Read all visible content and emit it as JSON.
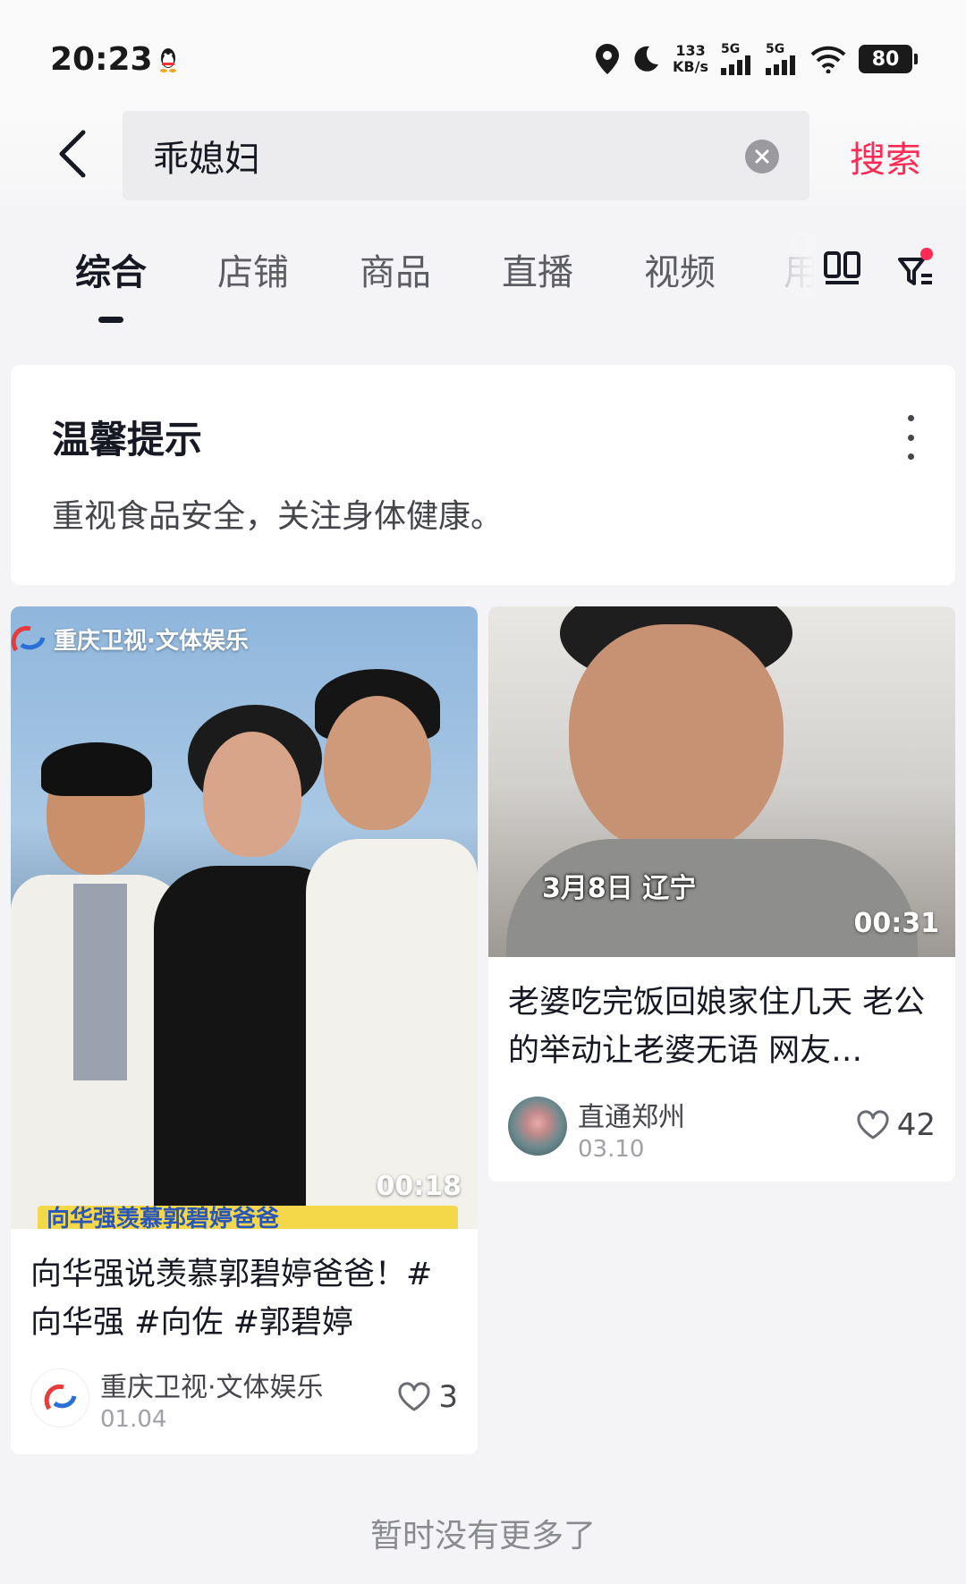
{
  "status_bar": {
    "time": "20:23",
    "net_speed_value": "133",
    "net_speed_unit": "KB/s",
    "signal_1": "5G",
    "signal_2": "5G",
    "battery": "80"
  },
  "search": {
    "query": "乖媳妇",
    "search_label": "搜索"
  },
  "tabs": [
    {
      "label": "综合",
      "active": true
    },
    {
      "label": "店铺"
    },
    {
      "label": "商品"
    },
    {
      "label": "直播"
    },
    {
      "label": "视频"
    },
    {
      "label": "用"
    }
  ],
  "tip": {
    "title": "温馨提示",
    "text": "重视食品安全，关注身体健康。"
  },
  "cards": [
    {
      "watermark": "重庆卫视·文体娱乐",
      "duration": "00:18",
      "banner": "向华强羡慕郭碧婷爸爸",
      "title": "向华强说羡慕郭碧婷爸爸！#向华强 #向佐 #郭碧婷",
      "author": "重庆卫视·文体娱乐",
      "date": "01.04",
      "likes": "3"
    },
    {
      "overlay": "3月8日 辽宁",
      "duration": "00:31",
      "title": "老婆吃完饭回娘家住几天 老公的举动让老婆无语 网友…",
      "author": "直通郑州",
      "date": "03.10",
      "likes": "42"
    }
  ],
  "footer": {
    "end_text": "暂时没有更多了"
  },
  "colors": {
    "accent": "#fe2c55",
    "text_primary": "#161823",
    "background": "#f4f4f6"
  }
}
